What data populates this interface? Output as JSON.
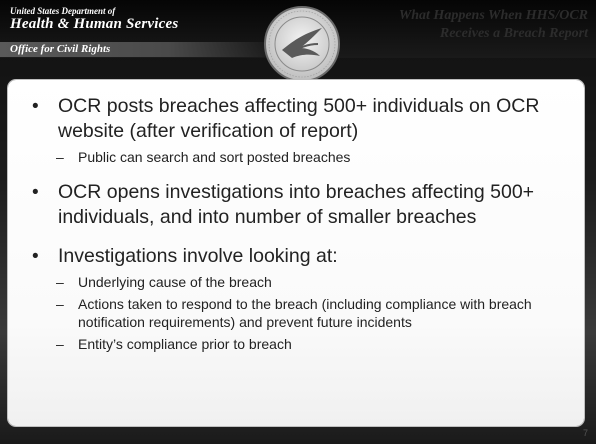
{
  "header": {
    "agency_line1": "United States Department of",
    "agency_line2": "Health & Human Services",
    "office": "Office for Civil Rights",
    "title": "What Happens When HHS/OCR Receives a Breach Report",
    "seal_icon": "hhs-seal-icon"
  },
  "colors": {
    "background_dark": "#1a1a1a",
    "content_bg": "#ffffff",
    "text": "#222222"
  },
  "bullets": [
    {
      "text": "OCR posts breaches affecting 500+ individuals on OCR website (after verification of report)",
      "subs": [
        "Public can search and sort posted breaches"
      ]
    },
    {
      "text": "OCR opens investigations into breaches affecting 500+ individuals, and into number of smaller breaches",
      "subs": []
    },
    {
      "text": "Investigations involve looking at:",
      "subs": [
        "Underlying cause of the breach",
        "Actions taken to respond to the breach (including compliance with breach notification requirements) and prevent future incidents",
        "Entity’s compliance prior to breach"
      ]
    }
  ],
  "slide_number": "7"
}
